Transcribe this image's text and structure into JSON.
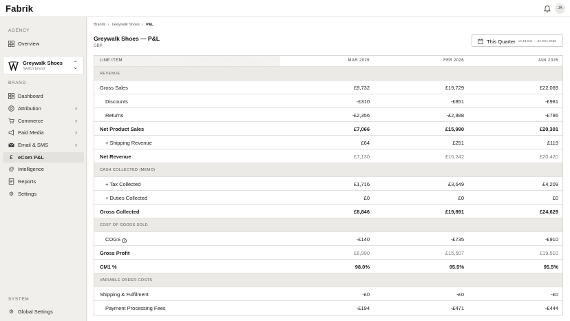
{
  "app": {
    "logo": "Fabrik",
    "avatar_initials": "JA"
  },
  "sidebar": {
    "agency_label": "AGENCY",
    "agency_items": [
      {
        "label": "Overview",
        "icon": "grid-icon"
      }
    ],
    "brand_switcher": {
      "name": "Greywalk Shoes",
      "subtitle": "Switch brand"
    },
    "brand_label": "BRAND",
    "brand_items": [
      {
        "label": "Dashboard",
        "icon": "dashboard-icon",
        "chevron": false
      },
      {
        "label": "Attribution",
        "icon": "target-icon",
        "chevron": true
      },
      {
        "label": "Commerce",
        "icon": "cart-icon",
        "chevron": true
      },
      {
        "label": "Paid Media",
        "icon": "megaphone-icon",
        "chevron": true
      },
      {
        "label": "Email & SMS",
        "icon": "mail-icon",
        "chevron": true
      },
      {
        "label": "eCom P&L",
        "icon": "pound-icon",
        "chevron": false,
        "active": true
      },
      {
        "label": "Intelligence",
        "icon": "at-icon",
        "chevron": false
      },
      {
        "label": "Reports",
        "icon": "report-icon",
        "chevron": false
      },
      {
        "label": "Settings",
        "icon": "gear-icon",
        "chevron": false
      }
    ],
    "system_label": "SYSTEM",
    "system_items": [
      {
        "label": "Global Settings",
        "icon": "gear-icon"
      }
    ]
  },
  "main": {
    "breadcrumb": [
      "Brands",
      "Greywalk Shoes",
      "P&L"
    ],
    "title": "Greywalk Shoes — P&L",
    "currency": "GBP",
    "quarter_button": {
      "label": "This Quarter",
      "range": "vs 18 Oct — 31 Dec 2025"
    },
    "table": {
      "headers": [
        "LINE ITEM",
        "MAR 2026",
        "FEB 2026",
        "JAN 2026"
      ],
      "rows": [
        {
          "type": "section",
          "label": "REVENUE"
        },
        {
          "type": "row",
          "label": "Gross Sales",
          "values": [
            "£9,732",
            "£19,729",
            "£22,069"
          ]
        },
        {
          "type": "row",
          "label": "Discounts",
          "indent": true,
          "values": [
            "-£310",
            "-£851",
            "-£981"
          ]
        },
        {
          "type": "row",
          "label": "Returns",
          "indent": true,
          "values": [
            "-£2,356",
            "-£2,888",
            "-£786"
          ]
        },
        {
          "type": "row",
          "label": "Net Product Sales",
          "bold": true,
          "values": [
            "£7,066",
            "£15,990",
            "£20,301"
          ]
        },
        {
          "type": "row",
          "label": "+ Shipping Revenue",
          "indent": true,
          "values": [
            "£64",
            "£251",
            "£119"
          ]
        },
        {
          "type": "row",
          "label": "Net Revenue",
          "bold": true,
          "muted": true,
          "values": [
            "£7,130",
            "£16,242",
            "£20,420"
          ]
        },
        {
          "type": "section",
          "label": "CASH COLLECTED (MEMO)"
        },
        {
          "type": "row",
          "label": "+ Tax Collected",
          "indent": true,
          "values": [
            "£1,716",
            "£3,649",
            "£4,209"
          ]
        },
        {
          "type": "row",
          "label": "+ Duties Collected",
          "indent": true,
          "values": [
            "£0",
            "£0",
            "£0"
          ]
        },
        {
          "type": "row",
          "label": "Gross Collected",
          "bold": true,
          "values": [
            "£8,846",
            "£19,891",
            "£24,629"
          ]
        },
        {
          "type": "section",
          "label": "COST OF GOODS SOLD"
        },
        {
          "type": "row",
          "label": "COGS",
          "indent": true,
          "info": true,
          "values": [
            "-£140",
            "-£735",
            "-£910"
          ]
        },
        {
          "type": "row",
          "label": "Gross Profit",
          "bold": true,
          "muted": true,
          "values": [
            "£6,990",
            "£15,507",
            "£19,510"
          ]
        },
        {
          "type": "row",
          "label": "CM1 %",
          "bold": true,
          "values": [
            "98.0%",
            "95.5%",
            "95.5%"
          ]
        },
        {
          "type": "section",
          "label": "VARIABLE ORDER COSTS"
        },
        {
          "type": "row",
          "label": "Shipping & Fulfilment",
          "values": [
            "-£0",
            "-£0",
            "-£0"
          ]
        },
        {
          "type": "row",
          "label": "Payment Processing Fees",
          "indent": true,
          "values": [
            "-£194",
            "-£471",
            "-£444"
          ]
        }
      ]
    }
  }
}
